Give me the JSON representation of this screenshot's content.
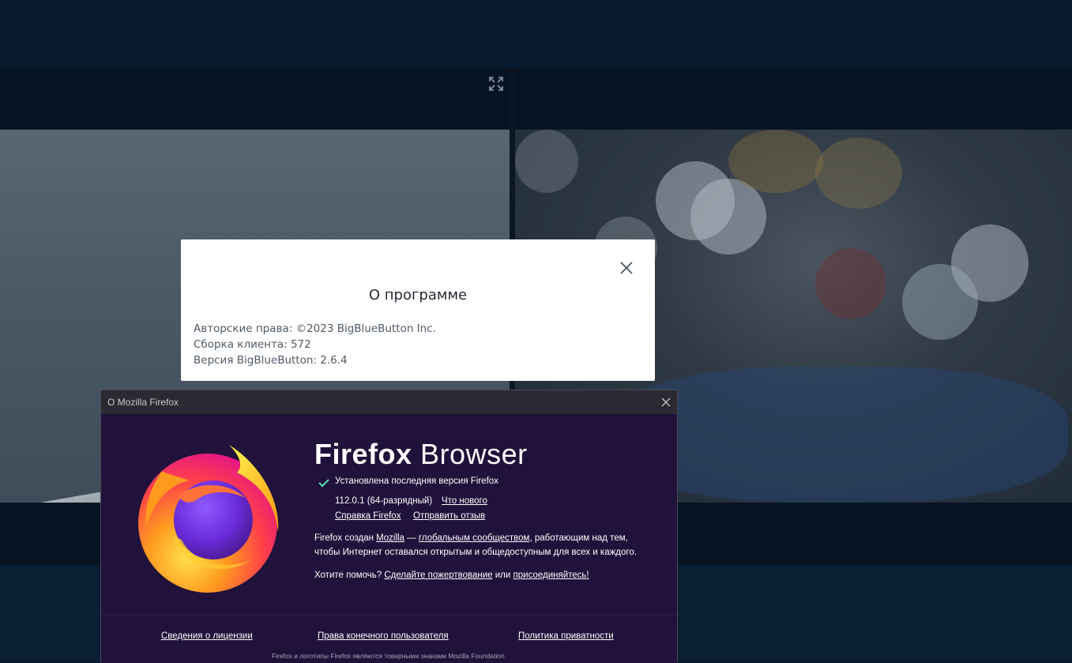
{
  "bbb_about": {
    "title": "О программе",
    "copyright": "Авторские права: ©2023 BigBlueButton Inc.",
    "client_build": "Сборка клиента: 572",
    "version": "Версия BigBlueButton: 2.6.4"
  },
  "firefox_about": {
    "window_title": "O Mozilla Firefox",
    "wordmark_bold": "Firefox",
    "wordmark_light": "Browser",
    "update_status": "Установлена последняя версия Firefox",
    "version": "112.0.1 (64-разрядный)",
    "whats_new_link": "Что нового",
    "help_link": "Справка Firefox",
    "feedback_link": "Отправить отзыв",
    "created_by_prefix": "Firefox создан ",
    "mozilla_link": "Mozilla",
    "dash": " — ",
    "community_link": "глобальным сообществом",
    "created_by_suffix": ", работающим над тем,",
    "created_by_line2": "чтобы Интернет оставался открытым и общедоступным для всех и каждого.",
    "help_prefix": "Хотите помочь? ",
    "donate_link": "Сделайте пожертвование",
    "help_or": " или ",
    "join_link": "присоединяйтесь!",
    "license_link": "Сведения о лицензии",
    "eula_link": "Права конечного пользователя",
    "privacy_link": "Политика приватности",
    "trademark": "Firefox и логотипы Firefox являются товарными знаками Mozilla Foundation."
  },
  "colors": {
    "background": "#081a2e",
    "firefox_body": "#20123a",
    "check_green": "#54ffbd"
  }
}
